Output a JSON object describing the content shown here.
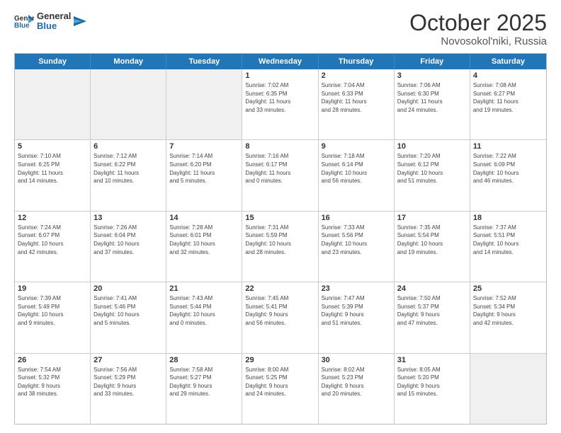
{
  "header": {
    "logo_general": "General",
    "logo_blue": "Blue",
    "month_title": "October 2025",
    "location": "Novosokol'niki, Russia"
  },
  "weekdays": [
    "Sunday",
    "Monday",
    "Tuesday",
    "Wednesday",
    "Thursday",
    "Friday",
    "Saturday"
  ],
  "rows": [
    [
      {
        "day": "",
        "lines": []
      },
      {
        "day": "",
        "lines": []
      },
      {
        "day": "",
        "lines": []
      },
      {
        "day": "1",
        "lines": [
          "Sunrise: 7:02 AM",
          "Sunset: 6:35 PM",
          "Daylight: 11 hours",
          "and 33 minutes."
        ]
      },
      {
        "day": "2",
        "lines": [
          "Sunrise: 7:04 AM",
          "Sunset: 6:33 PM",
          "Daylight: 11 hours",
          "and 28 minutes."
        ]
      },
      {
        "day": "3",
        "lines": [
          "Sunrise: 7:06 AM",
          "Sunset: 6:30 PM",
          "Daylight: 11 hours",
          "and 24 minutes."
        ]
      },
      {
        "day": "4",
        "lines": [
          "Sunrise: 7:08 AM",
          "Sunset: 6:27 PM",
          "Daylight: 11 hours",
          "and 19 minutes."
        ]
      }
    ],
    [
      {
        "day": "5",
        "lines": [
          "Sunrise: 7:10 AM",
          "Sunset: 6:25 PM",
          "Daylight: 11 hours",
          "and 14 minutes."
        ]
      },
      {
        "day": "6",
        "lines": [
          "Sunrise: 7:12 AM",
          "Sunset: 6:22 PM",
          "Daylight: 11 hours",
          "and 10 minutes."
        ]
      },
      {
        "day": "7",
        "lines": [
          "Sunrise: 7:14 AM",
          "Sunset: 6:20 PM",
          "Daylight: 11 hours",
          "and 5 minutes."
        ]
      },
      {
        "day": "8",
        "lines": [
          "Sunrise: 7:16 AM",
          "Sunset: 6:17 PM",
          "Daylight: 11 hours",
          "and 0 minutes."
        ]
      },
      {
        "day": "9",
        "lines": [
          "Sunrise: 7:18 AM",
          "Sunset: 6:14 PM",
          "Daylight: 10 hours",
          "and 56 minutes."
        ]
      },
      {
        "day": "10",
        "lines": [
          "Sunrise: 7:20 AM",
          "Sunset: 6:12 PM",
          "Daylight: 10 hours",
          "and 51 minutes."
        ]
      },
      {
        "day": "11",
        "lines": [
          "Sunrise: 7:22 AM",
          "Sunset: 6:09 PM",
          "Daylight: 10 hours",
          "and 46 minutes."
        ]
      }
    ],
    [
      {
        "day": "12",
        "lines": [
          "Sunrise: 7:24 AM",
          "Sunset: 6:07 PM",
          "Daylight: 10 hours",
          "and 42 minutes."
        ]
      },
      {
        "day": "13",
        "lines": [
          "Sunrise: 7:26 AM",
          "Sunset: 6:04 PM",
          "Daylight: 10 hours",
          "and 37 minutes."
        ]
      },
      {
        "day": "14",
        "lines": [
          "Sunrise: 7:28 AM",
          "Sunset: 6:01 PM",
          "Daylight: 10 hours",
          "and 32 minutes."
        ]
      },
      {
        "day": "15",
        "lines": [
          "Sunrise: 7:31 AM",
          "Sunset: 5:59 PM",
          "Daylight: 10 hours",
          "and 28 minutes."
        ]
      },
      {
        "day": "16",
        "lines": [
          "Sunrise: 7:33 AM",
          "Sunset: 5:56 PM",
          "Daylight: 10 hours",
          "and 23 minutes."
        ]
      },
      {
        "day": "17",
        "lines": [
          "Sunrise: 7:35 AM",
          "Sunset: 5:54 PM",
          "Daylight: 10 hours",
          "and 19 minutes."
        ]
      },
      {
        "day": "18",
        "lines": [
          "Sunrise: 7:37 AM",
          "Sunset: 5:51 PM",
          "Daylight: 10 hours",
          "and 14 minutes."
        ]
      }
    ],
    [
      {
        "day": "19",
        "lines": [
          "Sunrise: 7:39 AM",
          "Sunset: 5:49 PM",
          "Daylight: 10 hours",
          "and 9 minutes."
        ]
      },
      {
        "day": "20",
        "lines": [
          "Sunrise: 7:41 AM",
          "Sunset: 5:46 PM",
          "Daylight: 10 hours",
          "and 5 minutes."
        ]
      },
      {
        "day": "21",
        "lines": [
          "Sunrise: 7:43 AM",
          "Sunset: 5:44 PM",
          "Daylight: 10 hours",
          "and 0 minutes."
        ]
      },
      {
        "day": "22",
        "lines": [
          "Sunrise: 7:45 AM",
          "Sunset: 5:41 PM",
          "Daylight: 9 hours",
          "and 56 minutes."
        ]
      },
      {
        "day": "23",
        "lines": [
          "Sunrise: 7:47 AM",
          "Sunset: 5:39 PM",
          "Daylight: 9 hours",
          "and 51 minutes."
        ]
      },
      {
        "day": "24",
        "lines": [
          "Sunrise: 7:50 AM",
          "Sunset: 5:37 PM",
          "Daylight: 9 hours",
          "and 47 minutes."
        ]
      },
      {
        "day": "25",
        "lines": [
          "Sunrise: 7:52 AM",
          "Sunset: 5:34 PM",
          "Daylight: 9 hours",
          "and 42 minutes."
        ]
      }
    ],
    [
      {
        "day": "26",
        "lines": [
          "Sunrise: 7:54 AM",
          "Sunset: 5:32 PM",
          "Daylight: 9 hours",
          "and 38 minutes."
        ]
      },
      {
        "day": "27",
        "lines": [
          "Sunrise: 7:56 AM",
          "Sunset: 5:29 PM",
          "Daylight: 9 hours",
          "and 33 minutes."
        ]
      },
      {
        "day": "28",
        "lines": [
          "Sunrise: 7:58 AM",
          "Sunset: 5:27 PM",
          "Daylight: 9 hours",
          "and 29 minutes."
        ]
      },
      {
        "day": "29",
        "lines": [
          "Sunrise: 8:00 AM",
          "Sunset: 5:25 PM",
          "Daylight: 9 hours",
          "and 24 minutes."
        ]
      },
      {
        "day": "30",
        "lines": [
          "Sunrise: 8:02 AM",
          "Sunset: 5:23 PM",
          "Daylight: 9 hours",
          "and 20 minutes."
        ]
      },
      {
        "day": "31",
        "lines": [
          "Sunrise: 8:05 AM",
          "Sunset: 5:20 PM",
          "Daylight: 9 hours",
          "and 15 minutes."
        ]
      },
      {
        "day": "",
        "lines": []
      }
    ]
  ]
}
